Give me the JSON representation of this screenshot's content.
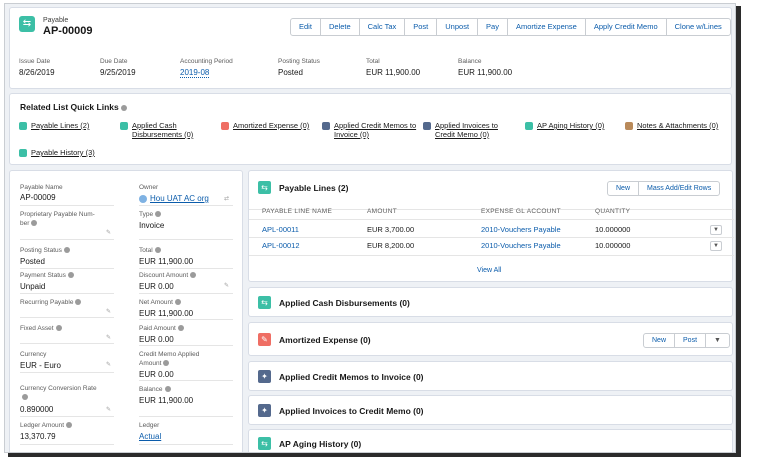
{
  "header": {
    "object_label": "Payable",
    "record_name": "AP-00009",
    "actions": [
      "Edit",
      "Delete",
      "Calc Tax",
      "Post",
      "Unpost",
      "Pay",
      "Amortize Expense",
      "Apply Credit Memo",
      "Clone w/Lines"
    ],
    "fields": [
      {
        "label": "Issue Date",
        "value": "8/26/2019"
      },
      {
        "label": "Due Date",
        "value": "9/25/2019"
      },
      {
        "label": "Accounting Period",
        "value": "2019-08"
      },
      {
        "label": "Posting Status",
        "value": "Posted"
      },
      {
        "label": "Total",
        "value": "EUR 11,900.00"
      },
      {
        "label": "Balance",
        "value": "EUR 11,900.00"
      }
    ]
  },
  "quick_links": {
    "title": "Related List Quick Links",
    "items": [
      {
        "label": "Payable Lines (2)",
        "color": "#3cbfa6"
      },
      {
        "label": "Applied Cash Disbursements (0)",
        "line1": "Applied Cash",
        "line2": "Disbursements (0)",
        "color": "#3cbfa6"
      },
      {
        "label": "Amortized Expense (0)",
        "color": "#ef6e64"
      },
      {
        "label": "Applied Credit Memos to Invoice (0)",
        "line1": "Applied Credit Memos to",
        "line2": "Invoice (0)",
        "color": "#54698d"
      },
      {
        "label": "Applied Invoices to Credit Memo (0)",
        "line1": "Applied Invoices to",
        "line2": "Credit Memo (0)",
        "color": "#54698d"
      },
      {
        "label": "AP Aging History (0)",
        "color": "#3cbfa6"
      },
      {
        "label": "Notes & Attachments (0)",
        "color": "#b98a5a"
      },
      {
        "label": "Payable History (3)",
        "color": "#3cbfa6"
      }
    ]
  },
  "details": {
    "left": [
      {
        "label": "Payable Name",
        "value": "AP-00009"
      },
      {
        "label": "Proprietary Payable Num-",
        "label2": "ber",
        "value": ""
      },
      {
        "label": "Posting Status",
        "value": "Posted"
      },
      {
        "label": "Payment Status",
        "value": "Unpaid"
      },
      {
        "label": "Recurring Payable",
        "value": ""
      },
      {
        "label": "Fixed Asset",
        "value": ""
      },
      {
        "label": "Currency",
        "value": "EUR - Euro"
      },
      {
        "label": "Currency Conversion Rate",
        "value": "0.890000"
      },
      {
        "label": "Ledger Amount",
        "value": "13,370.79"
      }
    ],
    "right": [
      {
        "label": "Owner",
        "value": "Hou UAT AC org"
      },
      {
        "label": "Type",
        "value": "Invoice"
      },
      {
        "label": "Total",
        "value": "EUR 11,900.00"
      },
      {
        "label": "Discount Amount",
        "value": "EUR 0.00"
      },
      {
        "label": "Net Amount",
        "value": "EUR 11,900.00"
      },
      {
        "label": "Paid Amount",
        "value": "EUR 0.00"
      },
      {
        "label": "Credit Memo Applied",
        "label2": "Amount",
        "value": "EUR 0.00"
      },
      {
        "label": "Balance",
        "value": "EUR 11,900.00"
      },
      {
        "label": "Ledger",
        "value": "Actual"
      }
    ]
  },
  "payable_lines": {
    "title": "Payable Lines (2)",
    "buttons": [
      "New",
      "Mass Add/Edit Rows"
    ],
    "columns": [
      "PAYABLE LINE NAME",
      "AMOUNT",
      "EXPENSE GL ACCOUNT",
      "QUANTITY"
    ],
    "rows": [
      [
        "APL-00011",
        "EUR 3,700.00",
        "2010-Vouchers Payable",
        "10.000000"
      ],
      [
        "APL-00012",
        "EUR 8,200.00",
        "2010-Vouchers Payable",
        "10.000000"
      ]
    ],
    "view_all": "View All"
  },
  "related_cards": [
    {
      "title": "Applied Cash Disbursements (0)",
      "color": "#3cbfa6"
    },
    {
      "title": "Amortized Expense (0)",
      "color": "#ef6e64",
      "buttons": [
        "New",
        "Post"
      ]
    },
    {
      "title": "Applied Credit Memos to Invoice (0)",
      "color": "#54698d"
    },
    {
      "title": "Applied Invoices to Credit Memo (0)",
      "color": "#54698d"
    },
    {
      "title": "AP Aging History (0)",
      "color": "#3cbfa6"
    }
  ]
}
